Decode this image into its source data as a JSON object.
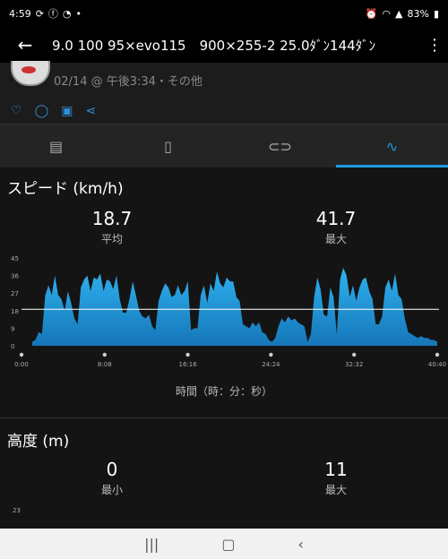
{
  "status": {
    "time": "4:59",
    "battery": "83%"
  },
  "appbar": {
    "title": "9.0 100 95×evo115　900×255-2 25.0ﾀﾞﾝ144ﾀﾞﾝ"
  },
  "header": {
    "date": "02/14 @ 午後3:34・その他"
  },
  "speed": {
    "title": "スピード (km/h)",
    "avg_value": "18.7",
    "avg_label": "平均",
    "max_value": "41.7",
    "max_label": "最大",
    "x_axis_label": "時間（時：分：秒）"
  },
  "altitude": {
    "title": "高度 (m)",
    "min_value": "0",
    "min_label": "最小",
    "max_value": "11",
    "max_label": "最大",
    "y_first_tick": "23"
  },
  "chart_data": {
    "type": "area",
    "xlabel": "時間（時：分：秒）",
    "ylabel": "スピード (km/h)",
    "y_ticks": [
      "45",
      "36",
      "27",
      "18",
      "9",
      "0"
    ],
    "x_ticks": [
      "0:00",
      "8:08",
      "16:16",
      "24:24",
      "32:32",
      "40:40"
    ],
    "ylim": [
      0,
      45
    ],
    "average_line": 18.7,
    "color": "#2aa0dc",
    "values": [
      2,
      3,
      7,
      6,
      26,
      31,
      26,
      36,
      26,
      24,
      18,
      28,
      22,
      14,
      11,
      30,
      34,
      36,
      28,
      35,
      34,
      37,
      28,
      34,
      33,
      29,
      36,
      24,
      17,
      17,
      24,
      33,
      26,
      18,
      15,
      14,
      16,
      10,
      8,
      23,
      28,
      32,
      30,
      25,
      26,
      31,
      26,
      28,
      33,
      8,
      9,
      9,
      26,
      31,
      22,
      32,
      28,
      38,
      32,
      30,
      35,
      33,
      33,
      25,
      23,
      11,
      10,
      9,
      12,
      10,
      12,
      7,
      6,
      3,
      2,
      4,
      10,
      14,
      12,
      15,
      13,
      14,
      12,
      11,
      10,
      2,
      6,
      25,
      35,
      29,
      16,
      15,
      30,
      25,
      6,
      34,
      40,
      36,
      25,
      31,
      23,
      30,
      34,
      35,
      28,
      24,
      11,
      11,
      15,
      30,
      34,
      28,
      37,
      26,
      24,
      14,
      7,
      6,
      5,
      4,
      5,
      4,
      4,
      3,
      3,
      2
    ]
  }
}
